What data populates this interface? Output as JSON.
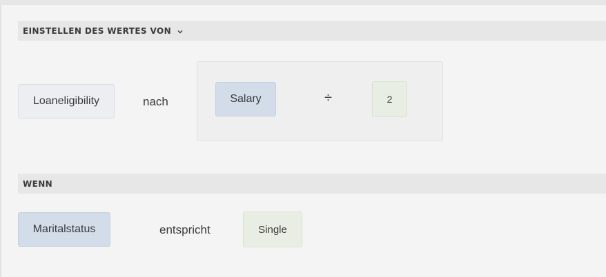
{
  "set_section": {
    "header": "EINSTELLEN DES WERTES VON",
    "target_field": "Loaneligibility",
    "connector": "nach",
    "expression": {
      "left_operand": "Salary",
      "operator": "÷",
      "right_operand": "2"
    }
  },
  "when_section": {
    "header": "WENN",
    "field": "Maritalstatus",
    "comparator": "entspricht",
    "value": "Single"
  },
  "icons": {
    "collapse": "chevron-down-icon"
  },
  "colors": {
    "background": "#f4f4f4",
    "header_bg": "#e7e7e7",
    "field_chip": "#d3ddea",
    "value_chip": "#e9eee5"
  }
}
